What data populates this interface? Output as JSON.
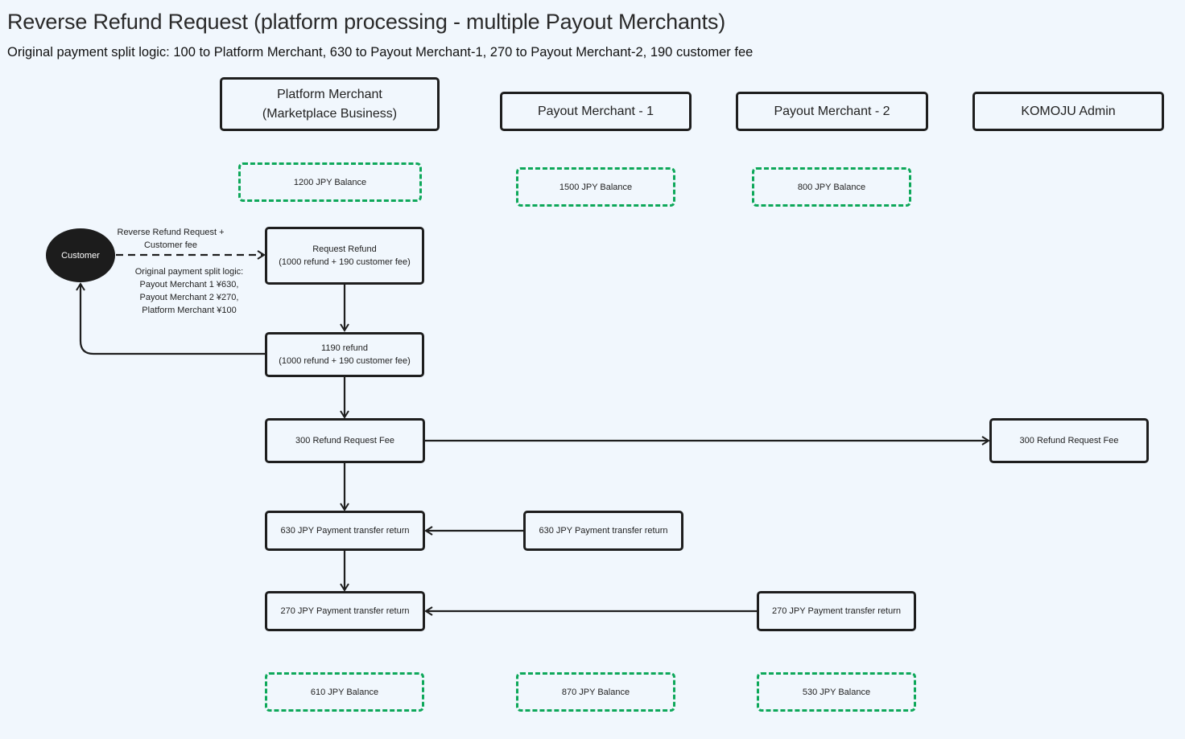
{
  "header": {
    "title": "Reverse Refund Request (platform processing - multiple Payout Merchants)",
    "subtitle": "Original payment split logic: 100 to Platform Merchant, 630 to Payout Merchant-1, 270 to Payout Merchant-2, 190 customer fee"
  },
  "colors": {
    "background": "#f1f7fd",
    "stroke": "#1e1e1e",
    "balance_border": "#0ea85a",
    "customer_fill": "#1c1c1c"
  },
  "lanes": {
    "platform": [
      "Platform Merchant",
      "(Marketplace Business)"
    ],
    "payout1": "Payout Merchant - 1",
    "payout2": "Payout Merchant - 2",
    "komoju": "KOMOJU Admin"
  },
  "balances_before": {
    "platform": "1200 JPY Balance",
    "payout1": "1500 JPY Balance",
    "payout2": "800 JPY Balance"
  },
  "balances_after": {
    "platform": "610 JPY Balance",
    "payout1": "870 JPY Balance",
    "payout2": "530 JPY Balance"
  },
  "customer": {
    "label": "Customer",
    "request_label": [
      "Reverse Refund Request +",
      "Customer fee"
    ],
    "split_label": [
      "Original payment split logic:",
      "Payout Merchant 1 ¥630,",
      "Payout Merchant 2 ¥270,",
      "Platform Merchant ¥100"
    ]
  },
  "steps": {
    "request_refund": [
      "Request Refund",
      "(1000 refund + 190 customer fee)"
    ],
    "refund": [
      "1190 refund",
      "(1000 refund + 190 customer fee)"
    ],
    "fee_platform": "300 Refund Request Fee",
    "fee_komoju": "300 Refund Request Fee",
    "transfer630_platform": "630 JPY Payment transfer return",
    "transfer630_payout1": "630 JPY Payment transfer return",
    "transfer270_platform": "270 JPY Payment transfer return",
    "transfer270_payout2": "270 JPY Payment transfer return"
  },
  "edges": [
    {
      "from": "customer",
      "to": "request_refund",
      "style": "dashed"
    },
    {
      "from": "request_refund",
      "to": "refund",
      "style": "solid"
    },
    {
      "from": "refund",
      "to": "customer",
      "style": "solid"
    },
    {
      "from": "refund",
      "to": "fee_platform",
      "style": "solid"
    },
    {
      "from": "fee_platform",
      "to": "fee_komoju",
      "style": "solid"
    },
    {
      "from": "fee_platform",
      "to": "transfer630_platform",
      "style": "solid"
    },
    {
      "from": "transfer630_payout1",
      "to": "transfer630_platform",
      "style": "solid"
    },
    {
      "from": "transfer630_platform",
      "to": "transfer270_platform",
      "style": "solid"
    },
    {
      "from": "transfer270_payout2",
      "to": "transfer270_platform",
      "style": "solid"
    }
  ]
}
